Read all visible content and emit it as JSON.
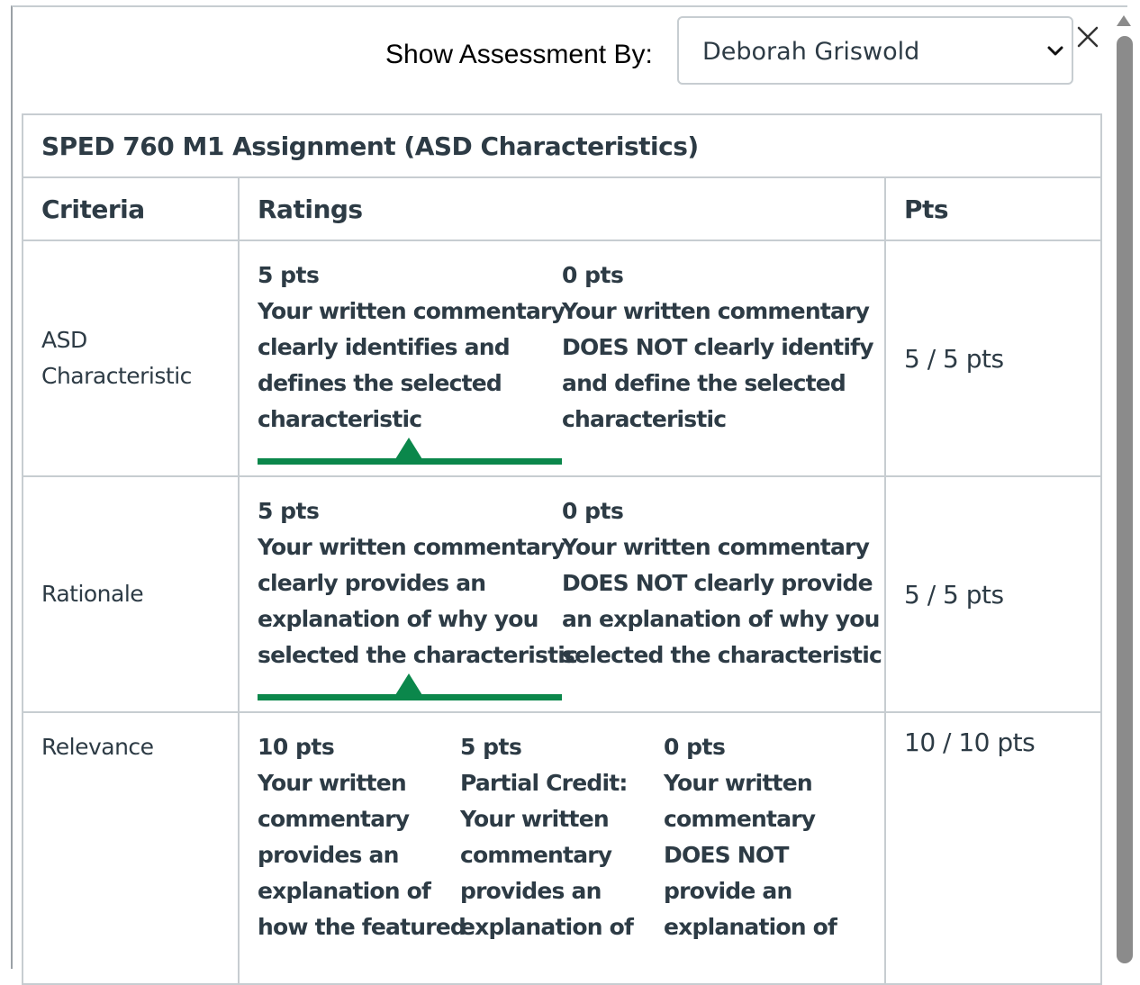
{
  "header": {
    "show_label": "Show Assessment By:",
    "selected_assessor": "Deborah Griswold"
  },
  "rubric": {
    "title": "SPED 760 M1 Assignment (ASD Characteristics)",
    "columns": {
      "criteria": "Criteria",
      "ratings": "Ratings",
      "pts": "Pts"
    },
    "rows": [
      {
        "criterion_line1": "ASD",
        "criterion_line2": "Characteristic",
        "ratings": [
          {
            "pts": "5 pts",
            "lines": [
              "Your written commentary",
              "clearly identifies and",
              "defines the selected",
              "characteristic"
            ]
          },
          {
            "pts": "0 pts",
            "lines": [
              "Your written commentary",
              "DOES NOT clearly identify",
              "and define the selected",
              "characteristic"
            ]
          }
        ],
        "score": "5 / 5 pts",
        "selected_rating": 0
      },
      {
        "criterion_line1": "Rationale",
        "ratings": [
          {
            "pts": "5 pts",
            "lines": [
              "Your written commentary",
              "clearly provides an",
              "explanation of why you",
              "selected the characteristic"
            ]
          },
          {
            "pts": "0 pts",
            "lines": [
              "Your written commentary",
              "DOES NOT clearly provide",
              "an explanation of why you",
              "selected the characteristic"
            ]
          }
        ],
        "score": "5 / 5 pts",
        "selected_rating": 0
      },
      {
        "criterion_line1": "Relevance",
        "ratings": [
          {
            "pts": "10 pts",
            "lines": [
              "Your written",
              "commentary",
              "provides an",
              "explanation of",
              "how the featured"
            ]
          },
          {
            "pts": "5 pts",
            "lines": [
              "Partial Credit:",
              "Your written",
              "commentary",
              "provides an",
              "explanation of"
            ]
          },
          {
            "pts": "0 pts",
            "lines": [
              "Your written",
              "commentary",
              "DOES NOT",
              "provide an",
              "explanation of"
            ]
          }
        ],
        "score": "10 / 10 pts"
      }
    ]
  },
  "icons": {
    "select": "chevron-down-icon",
    "close": "close-icon",
    "scroll": "scroll-up-arrow-icon"
  },
  "colors": {
    "selected_rating": "#0b874b",
    "border": "#c7cdd1",
    "text": "#2d3b45"
  }
}
